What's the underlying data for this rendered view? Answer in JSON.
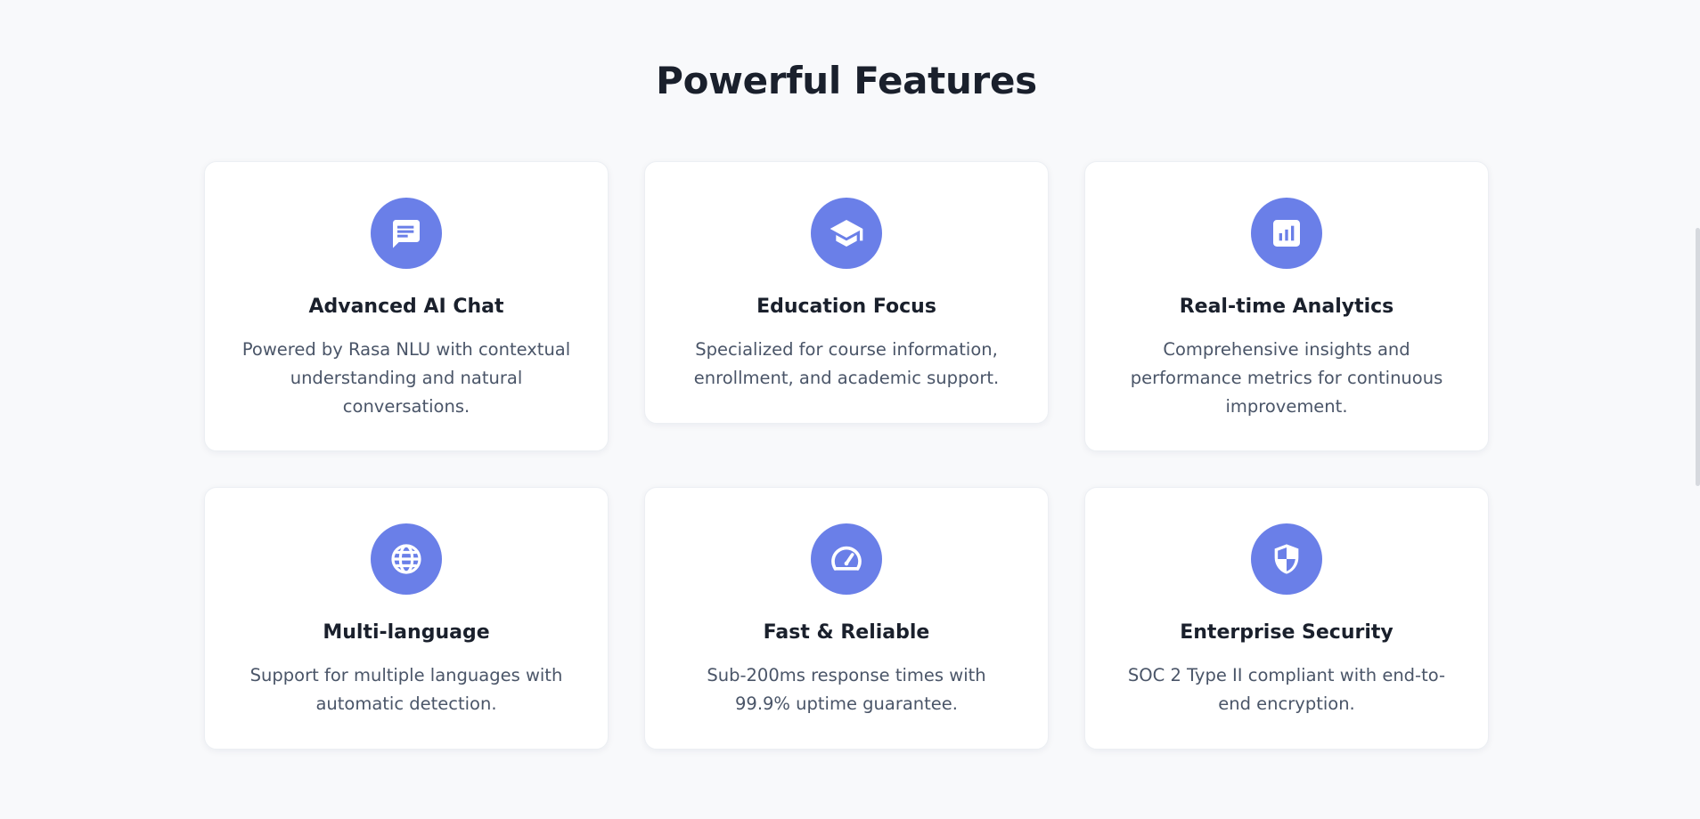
{
  "section": {
    "title": "Powerful Features"
  },
  "features": [
    {
      "icon": "chat-icon",
      "title": "Advanced AI Chat",
      "description": "Powered by Rasa NLU with contextual understanding and natural conversations."
    },
    {
      "icon": "graduation-cap-icon",
      "title": "Education Focus",
      "description": "Specialized for course information, enrollment, and academic support."
    },
    {
      "icon": "analytics-icon",
      "title": "Real-time Analytics",
      "description": "Comprehensive insights and performance metrics for continuous improvement."
    },
    {
      "icon": "globe-icon",
      "title": "Multi-language",
      "description": "Support for multiple languages with automatic detection."
    },
    {
      "icon": "speedometer-icon",
      "title": "Fast & Reliable",
      "description": "Sub-200ms response times with 99.9% uptime guarantee."
    },
    {
      "icon": "shield-icon",
      "title": "Enterprise Security",
      "description": "SOC 2 Type II compliant with end-to-end encryption."
    }
  ],
  "colors": {
    "accent": "#6a7fe8",
    "background": "#f8f9fb",
    "card": "#ffffff",
    "title_text": "#1a202c",
    "body_text": "#4a5568"
  }
}
